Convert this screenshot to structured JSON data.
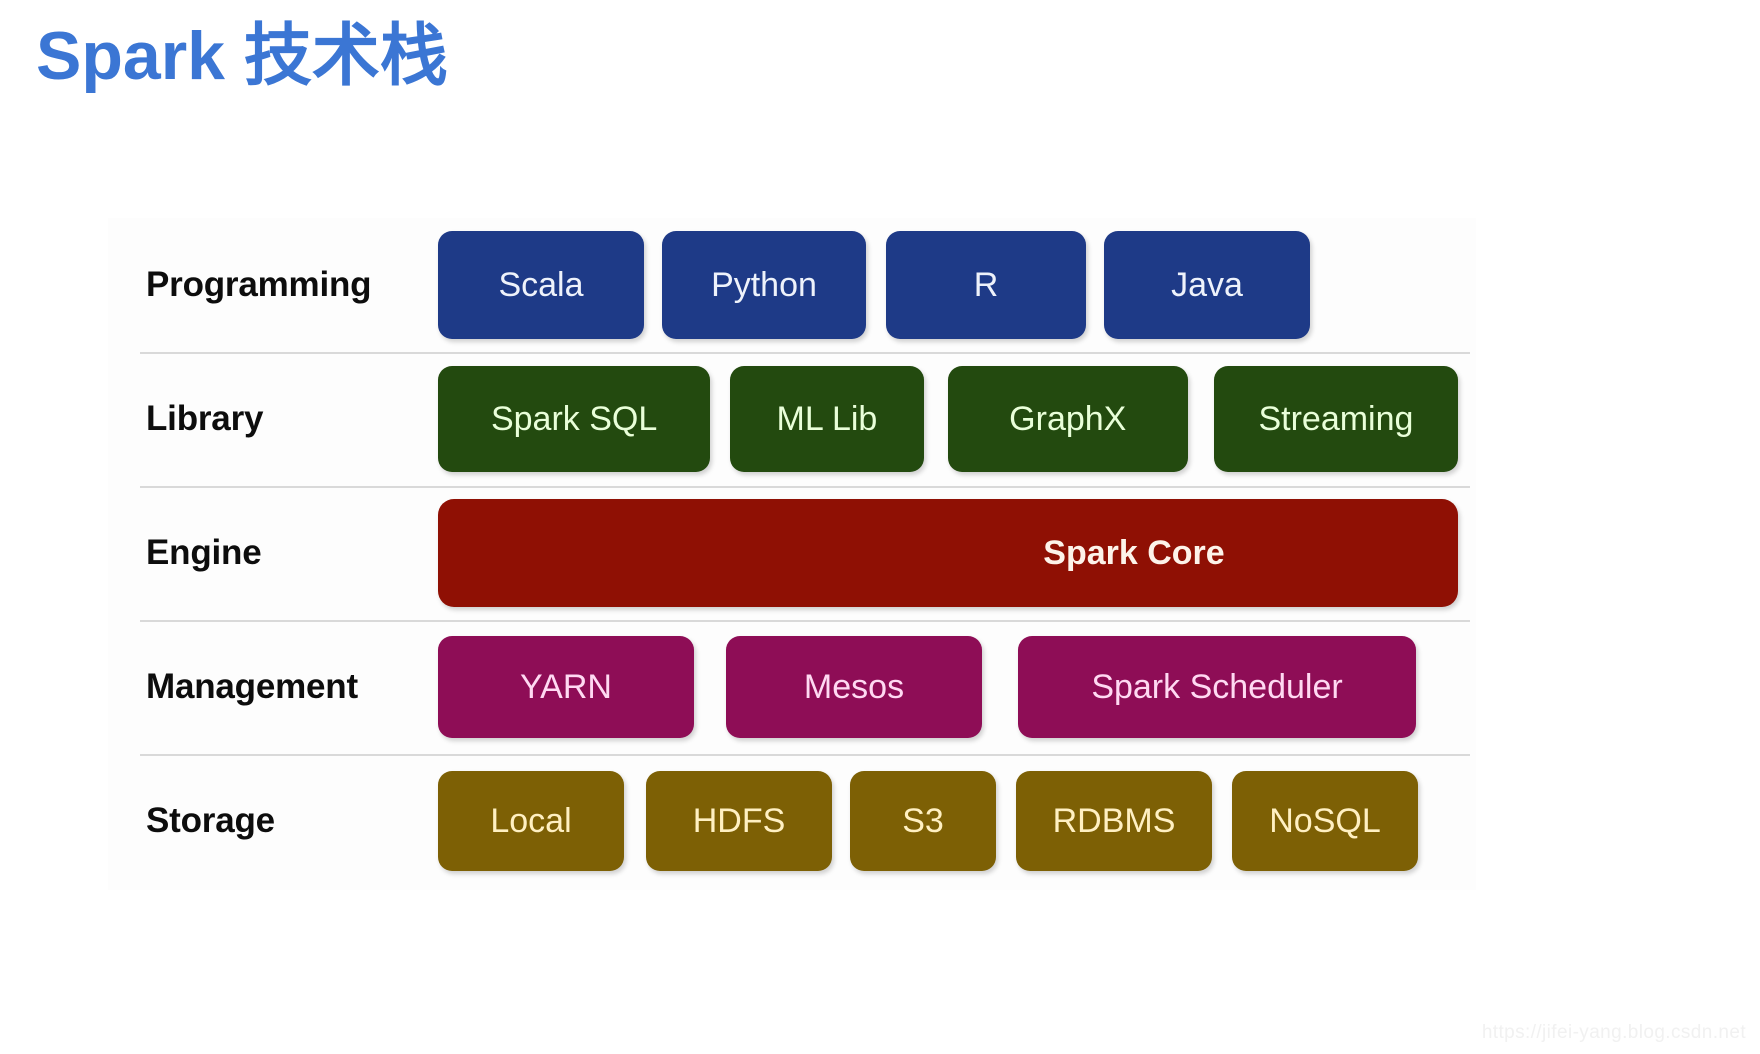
{
  "slide": {
    "title_latin": "Spark",
    "title_cjk": "技术栈",
    "title_color": "#3b76d4",
    "background_color": "#ffffff"
  },
  "diagram": {
    "type": "layered-stack",
    "rows": [
      {
        "label": "Programming",
        "theme": "programming",
        "box_color": "#1e3a87",
        "text_color": "#eef2fb",
        "items": [
          "Scala",
          "Python",
          "R",
          "Java"
        ]
      },
      {
        "label": "Library",
        "theme": "library",
        "box_color": "#234a0f",
        "text_color": "#e9ffd9",
        "items": [
          "Spark SQL",
          "ML Lib",
          "GraphX",
          "Streaming"
        ]
      },
      {
        "label": "Engine",
        "theme": "engine",
        "box_color": "#8f1004",
        "text_color": "#fdf3ea",
        "items": [
          "Spark Core"
        ]
      },
      {
        "label": "Management",
        "theme": "management",
        "box_color": "#8e0d56",
        "text_color": "#ffd9f2",
        "items": [
          "YARN",
          "Mesos",
          "Spark Scheduler"
        ]
      },
      {
        "label": "Storage",
        "theme": "storage",
        "box_color": "#7d6005",
        "text_color": "#fff0c2",
        "items": [
          "Local",
          "HDFS",
          "S3",
          "RDBMS",
          "NoSQL"
        ]
      }
    ],
    "divider_color": "#d9d9d9"
  },
  "watermark": {
    "text": "https://jifei-yang.blog.csdn.net",
    "color": "#f1f1f1"
  }
}
